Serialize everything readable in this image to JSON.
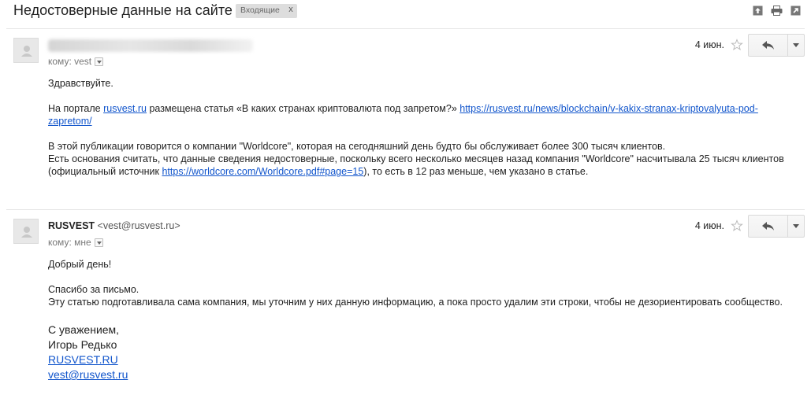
{
  "thread": {
    "subject": "Недостоверные данные на сайте",
    "label": "Входящие",
    "label_close": "x"
  },
  "icons": {
    "archive": "archive-icon",
    "print": "print-icon",
    "new_window": "new-window-icon"
  },
  "messages": [
    {
      "sender_name": "",
      "sender_email": "",
      "recipient": "кому: vest",
      "date": "4 июн.",
      "body": {
        "greeting": "Здравствуйте.",
        "p1_a": "На портале ",
        "p1_link1": "rusvest.ru",
        "p1_b": " размещена статья «В каких странах криптовалюта под запретом?» ",
        "p1_link2": "https://rusvest.ru/news/blockchain/v-kakix-stranax-kriptovalyuta-pod-zapretom/",
        "p2_line1": "В этой публикации говорится о компании \"Worldcore\", которая на сегодняшний день будто бы обслуживает более 300 тысяч клиентов.",
        "p2_line2": "Есть основания считать, что данные сведения недостоверные, поскольку всего несколько месяцев назад компания \"Worldcore\" насчитывала 25 тысяч клиентов (официальный источник ",
        "p2_link": "https://worldcore.com/Worldcore.pdf#page=15",
        "p2_end": "), то есть в 12 раз меньше, чем указано в статье."
      }
    },
    {
      "sender_name": "RUSVEST",
      "sender_email": "<vest@rusvest.ru>",
      "recipient": "кому: мне",
      "date": "4 июн.",
      "body": {
        "greeting": "Добрый день!",
        "line1": "Спасибо за письмо.",
        "line2": "Эту статью подготавливала сама компания, мы уточним у них данную информацию, а пока просто удалим эти строки, чтобы не дезориентировать сообщество.",
        "sig1": "С уважением,",
        "sig2": "Игорь Редько",
        "sig_link1": "RUSVEST.RU",
        "sig_link2": "vest@rusvest.ru"
      }
    }
  ]
}
